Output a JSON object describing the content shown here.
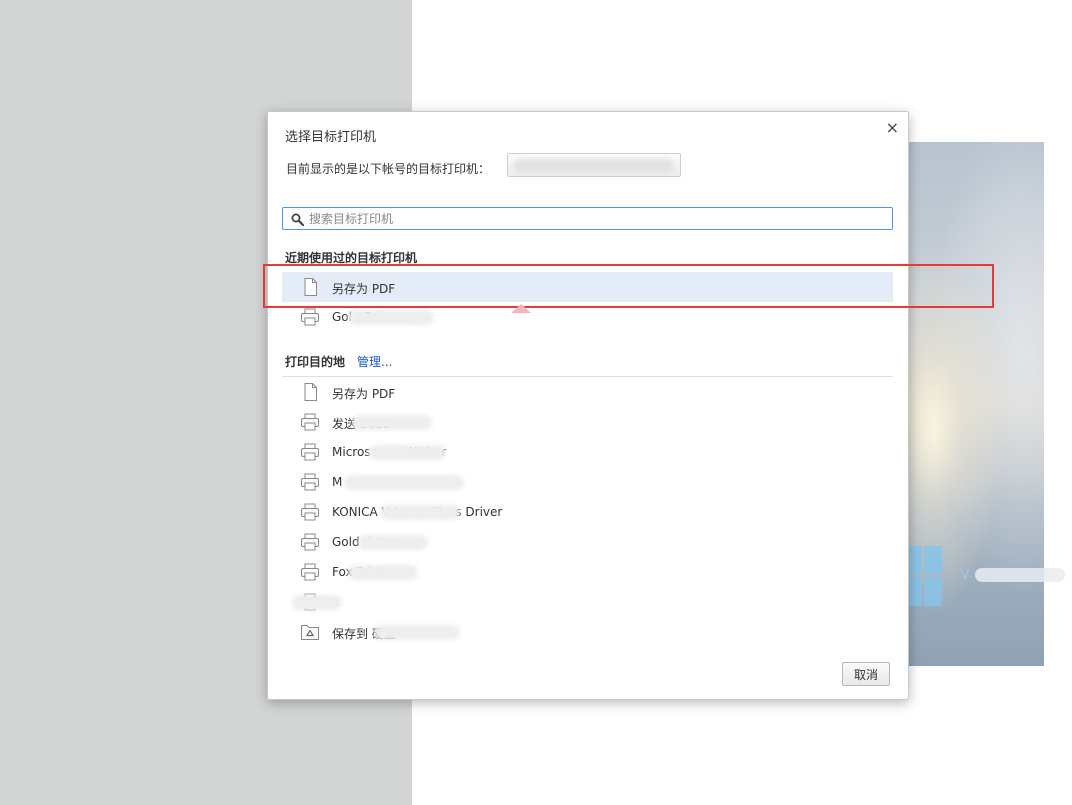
{
  "dialog": {
    "title": "选择目标打印机",
    "close_glyph": "×",
    "account_label": "目前显示的是以下帐号的目标打印机：",
    "account_value": "",
    "search": {
      "placeholder": "搜索目标打印机",
      "value": ""
    },
    "recent": {
      "heading": "近期使用过的目标打印机",
      "items": [
        {
          "label": "另存为 PDF",
          "icon": "pdf-document-icon",
          "selected": true
        },
        {
          "label": "Gol           t Printer",
          "icon": "printer-icon",
          "selected": false
        }
      ]
    },
    "destinations": {
      "heading": "打印目的地",
      "manage_label": "管理...",
      "items": [
        {
          "label": "另存为 PDF",
          "icon": "pdf-document-icon"
        },
        {
          "label": "发送                2013",
          "icon": "printer-icon"
        },
        {
          "label": "Micros                ment Writer",
          "icon": "printer-icon"
        },
        {
          "label": "M",
          "icon": "printer-icon"
        },
        {
          "label": "KONICA                  V Laser Class Driver",
          "icon": "printer-icon"
        },
        {
          "label": "Gold                 rinter",
          "icon": "printer-icon"
        },
        {
          "label": "Fox              Printer",
          "icon": "printer-icon"
        },
        {
          "label": "   x",
          "icon": "printer-icon"
        },
        {
          "label": "保存到                  硬盘",
          "icon": "google-drive-icon"
        }
      ]
    },
    "cancel_label": "取消"
  },
  "colors": {
    "accent_link": "#1a58c8",
    "selected_row": "#e4ecf7",
    "search_border": "#4d90fe",
    "annotation_red": "#e33a3a",
    "left_backdrop": "#d3d4d4"
  }
}
